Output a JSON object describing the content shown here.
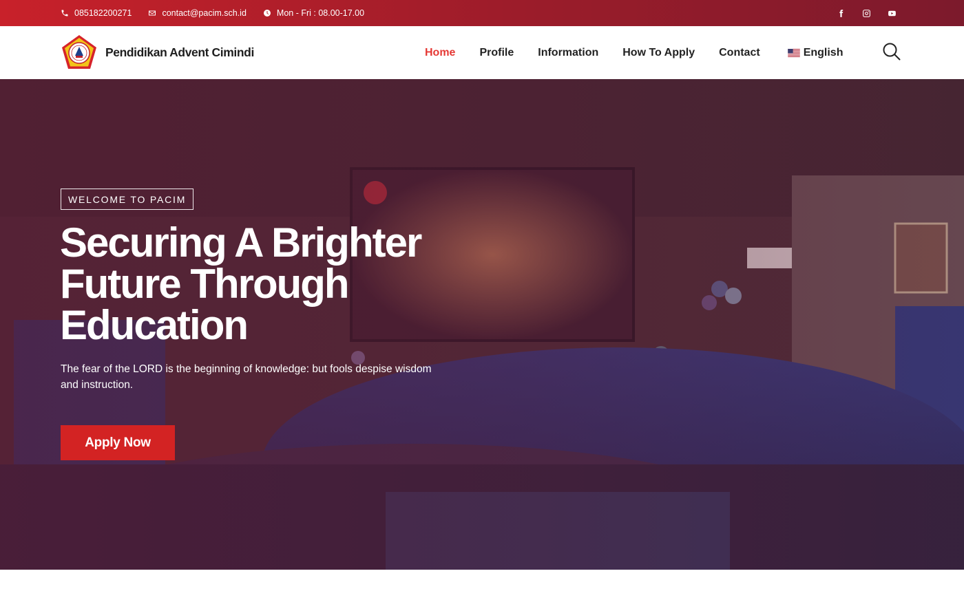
{
  "topbar": {
    "phone": "085182200271",
    "email": "contact@pacim.sch.id",
    "hours": "Mon - Fri : 08.00-17.00",
    "social": [
      "facebook-icon",
      "instagram-icon",
      "youtube-icon"
    ]
  },
  "header": {
    "brand_name": "Pendidikan Advent Cimindi",
    "nav": [
      {
        "label": "Home",
        "active": true
      },
      {
        "label": "Profile",
        "active": false
      },
      {
        "label": "Information",
        "active": false
      },
      {
        "label": "How To Apply",
        "active": false
      },
      {
        "label": "Contact",
        "active": false
      }
    ],
    "language": "English",
    "language_flag": "us-flag-icon"
  },
  "hero": {
    "badge": "WELCOME TO PACIM",
    "title": "Securing A Brighter Future Through Education",
    "subtitle": "The fear of the LORD is the beginning of knowledge: but fools despise wisdom and instruction.",
    "cta_label": "Apply Now"
  },
  "colors": {
    "accent": "#d32323",
    "nav_active": "#e53935",
    "topbar_start": "#c8212a",
    "topbar_end": "#7c1a2c",
    "hero_overlay": "#5c1a34"
  }
}
